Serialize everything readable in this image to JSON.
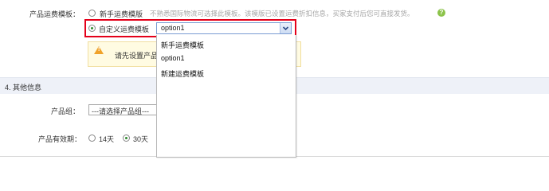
{
  "shipping": {
    "label": "产品运费模板：",
    "novice_option": "新手运费模版",
    "novice_hint": "不熟悉国际物流可选择此模板。该模版已设置运费折扣信息，买家支付后您可直接发货。",
    "help_icon_glyph": "?",
    "custom_option": "自定义运费模板",
    "selected_template": "option1",
    "warning_text": "请先设置产品"
  },
  "dropdown": {
    "options": [
      "新手运费模板",
      "option1",
      "新建运费模板"
    ]
  },
  "other_info": {
    "section_title": "4. 其他信息",
    "group_label": "产品组：",
    "group_placeholder": "---请选择产品组---",
    "validity_label": "产品有效期：",
    "validity_options": [
      "14天",
      "30天"
    ],
    "validity_selected": "30天"
  },
  "colors": {
    "highlight_border": "#e4001a",
    "section_bg": "#eef1f8",
    "warning_bg": "#fffbe2",
    "help_green": "#8cc34a"
  }
}
